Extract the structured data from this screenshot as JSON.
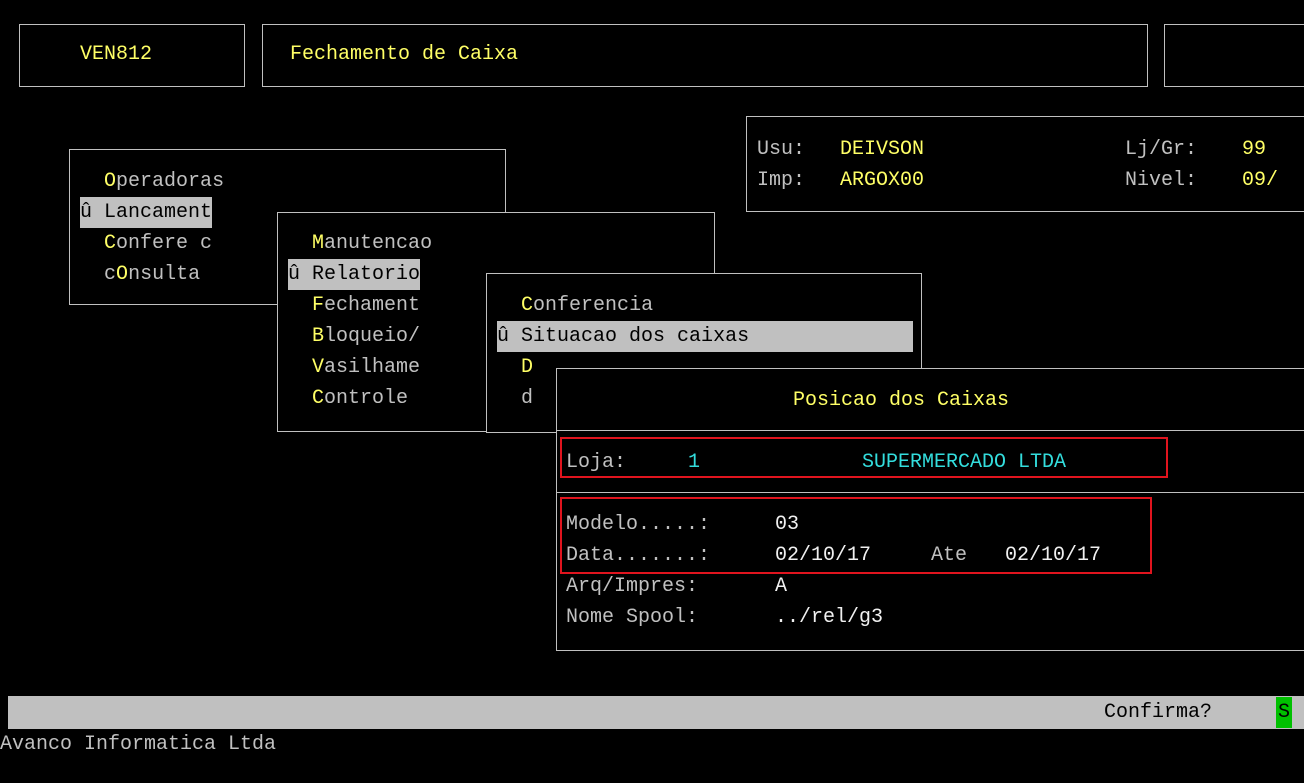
{
  "header": {
    "program_code": "VEN812",
    "screen_title": "Fechamento de Caixa"
  },
  "user_panel": {
    "user_label": "Usu:",
    "user_value": "DEIVSON",
    "printer_label": "Imp:",
    "printer_value": "ARGOX00",
    "store_group_label": "Lj/Gr:",
    "store_group_value": "99",
    "level_label": "Nivel:",
    "level_value": "09/"
  },
  "menu1": {
    "items": [
      {
        "prefix": " ",
        "text": "Operadoras",
        "first": "O",
        "rest": "peradoras"
      },
      {
        "prefix": "û",
        "text": "Lancament",
        "first": "L",
        "rest": "ancament",
        "selected": true
      },
      {
        "prefix": " ",
        "text": "Confere c",
        "first": "C",
        "rest": "onfere c"
      },
      {
        "prefix": " ",
        "text": "cOnsulta",
        "first": "c",
        "rest": "Onsulta"
      }
    ]
  },
  "menu2": {
    "items": [
      {
        "prefix": " ",
        "text": "Manutencao",
        "first": "M",
        "rest": "anutencao"
      },
      {
        "prefix": "û",
        "text": "Relatorio",
        "first": "R",
        "rest": "elatorio",
        "selected": true
      },
      {
        "prefix": " ",
        "text": "Fechament",
        "first": "F",
        "rest": "echament"
      },
      {
        "prefix": " ",
        "text": "Bloqueio/",
        "first": "B",
        "rest": "loqueio/"
      },
      {
        "prefix": " ",
        "text": "Vasilhame",
        "first": "V",
        "rest": "asilhame"
      },
      {
        "prefix": " ",
        "text": "Controle",
        "first": "C",
        "rest": "ontrole"
      }
    ]
  },
  "menu3": {
    "items": [
      {
        "prefix": " ",
        "text": "Conferencia",
        "first": "C",
        "rest": "onferencia"
      },
      {
        "prefix": "û",
        "text": "Situacao dos caixas",
        "first": "S",
        "rest": "ituacao dos caixas",
        "selected": true
      },
      {
        "prefix": " ",
        "text": "D",
        "first": "D",
        "rest": ""
      },
      {
        "prefix": " ",
        "text": "d",
        "first": "d",
        "rest": ""
      }
    ]
  },
  "dialog": {
    "title": "Posicao dos Caixas",
    "store_label": "Loja:",
    "store_number": "1",
    "store_name": "SUPERMERCADO LTDA",
    "model_label": "Modelo.....:",
    "model_value": "03",
    "date_label": "Data.......:",
    "date_from": "02/10/17",
    "date_sep": "Ate",
    "date_to": "02/10/17",
    "output_label": "Arq/Impres:",
    "output_value": "A",
    "spool_label": "Nome Spool:",
    "spool_value": "../rel/g3"
  },
  "status_bar": {
    "prompt": "Confirma?",
    "answer": "S"
  },
  "footer": {
    "company": "Avanco Informatica Ltda"
  },
  "colors": {
    "background": "#000000",
    "text": "#c0c0c0",
    "highlight": "#ffff66",
    "accent_cyan": "#33dddd",
    "selection_bg": "#c0c0c0",
    "confirm_green": "#00c000",
    "callout_red": "#e0141e"
  }
}
